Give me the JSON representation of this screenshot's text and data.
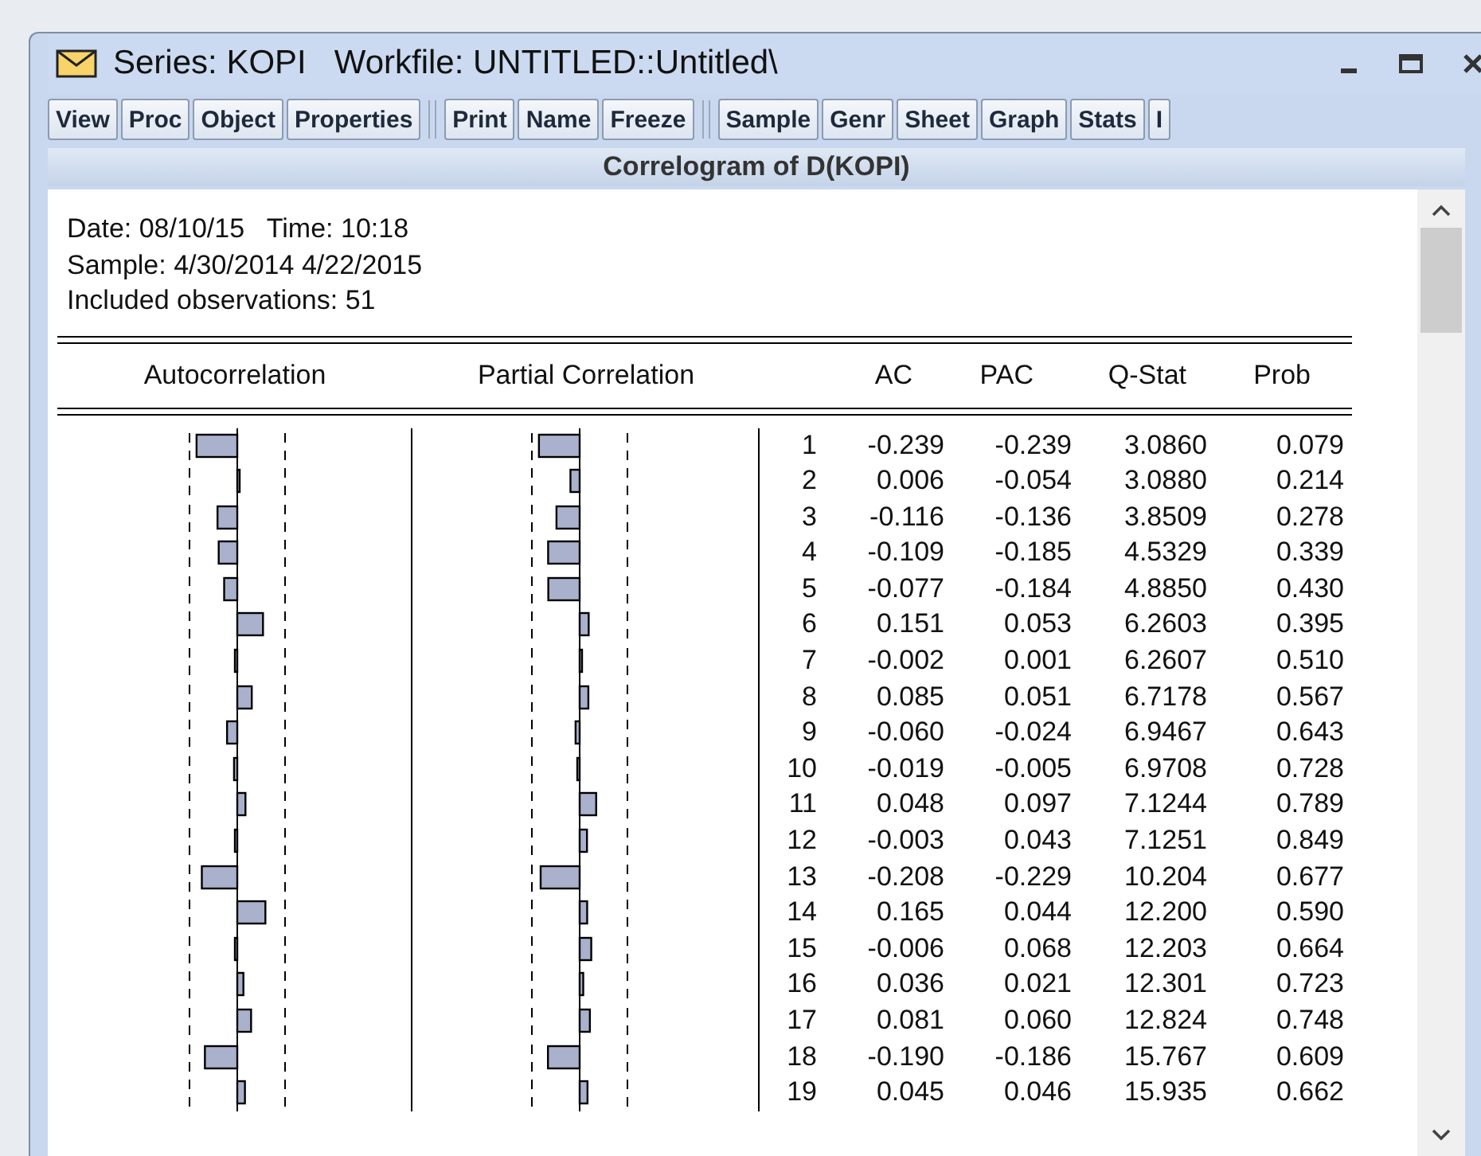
{
  "window": {
    "title": "Series: KOPI   Workfile: UNTITLED::Untitled\\"
  },
  "toolbar": [
    [
      "View",
      "Proc",
      "Object",
      "Properties"
    ],
    [
      "Print",
      "Name",
      "Freeze"
    ],
    [
      "Sample",
      "Genr",
      "Sheet",
      "Graph",
      "Stats",
      "I"
    ]
  ],
  "view_title": "Correlogram of D(KOPI)",
  "info": [
    "Date: 08/10/15   Time: 10:18",
    "Sample: 4/30/2014 4/22/2015",
    "Included observations: 51"
  ],
  "table": {
    "columns": [
      "Autocorrelation",
      "Partial Correlation",
      "AC",
      "PAC",
      "Q-Stat",
      "Prob"
    ],
    "rows": [
      {
        "lag": "1",
        "ac": "-0.239",
        "pac": "-0.239",
        "q_stat": "3.0860",
        "prob": "0.079"
      },
      {
        "lag": "2",
        "ac": "0.006",
        "pac": "-0.054",
        "q_stat": "3.0880",
        "prob": "0.214"
      },
      {
        "lag": "3",
        "ac": "-0.116",
        "pac": "-0.136",
        "q_stat": "3.8509",
        "prob": "0.278"
      },
      {
        "lag": "4",
        "ac": "-0.109",
        "pac": "-0.185",
        "q_stat": "4.5329",
        "prob": "0.339"
      },
      {
        "lag": "5",
        "ac": "-0.077",
        "pac": "-0.184",
        "q_stat": "4.8850",
        "prob": "0.430"
      },
      {
        "lag": "6",
        "ac": "0.151",
        "pac": "0.053",
        "q_stat": "6.2603",
        "prob": "0.395"
      },
      {
        "lag": "7",
        "ac": "-0.002",
        "pac": "0.001",
        "q_stat": "6.2607",
        "prob": "0.510"
      },
      {
        "lag": "8",
        "ac": "0.085",
        "pac": "0.051",
        "q_stat": "6.7178",
        "prob": "0.567"
      },
      {
        "lag": "9",
        "ac": "-0.060",
        "pac": "-0.024",
        "q_stat": "6.9467",
        "prob": "0.643"
      },
      {
        "lag": "10",
        "ac": "-0.019",
        "pac": "-0.005",
        "q_stat": "6.9708",
        "prob": "0.728"
      },
      {
        "lag": "11",
        "ac": "0.048",
        "pac": "0.097",
        "q_stat": "7.1244",
        "prob": "0.789"
      },
      {
        "lag": "12",
        "ac": "-0.003",
        "pac": "0.043",
        "q_stat": "7.1251",
        "prob": "0.849"
      },
      {
        "lag": "13",
        "ac": "-0.208",
        "pac": "-0.229",
        "q_stat": "10.204",
        "prob": "0.677"
      },
      {
        "lag": "14",
        "ac": "0.165",
        "pac": "0.044",
        "q_stat": "12.200",
        "prob": "0.590"
      },
      {
        "lag": "15",
        "ac": "-0.006",
        "pac": "0.068",
        "q_stat": "12.203",
        "prob": "0.664"
      },
      {
        "lag": "16",
        "ac": "0.036",
        "pac": "0.021",
        "q_stat": "12.301",
        "prob": "0.723"
      },
      {
        "lag": "17",
        "ac": "0.081",
        "pac": "0.060",
        "q_stat": "12.824",
        "prob": "0.748"
      },
      {
        "lag": "18",
        "ac": "-0.190",
        "pac": "-0.186",
        "q_stat": "15.767",
        "prob": "0.609"
      },
      {
        "lag": "19",
        "ac": "0.045",
        "pac": "0.046",
        "q_stat": "15.935",
        "prob": "0.662"
      }
    ]
  }
}
